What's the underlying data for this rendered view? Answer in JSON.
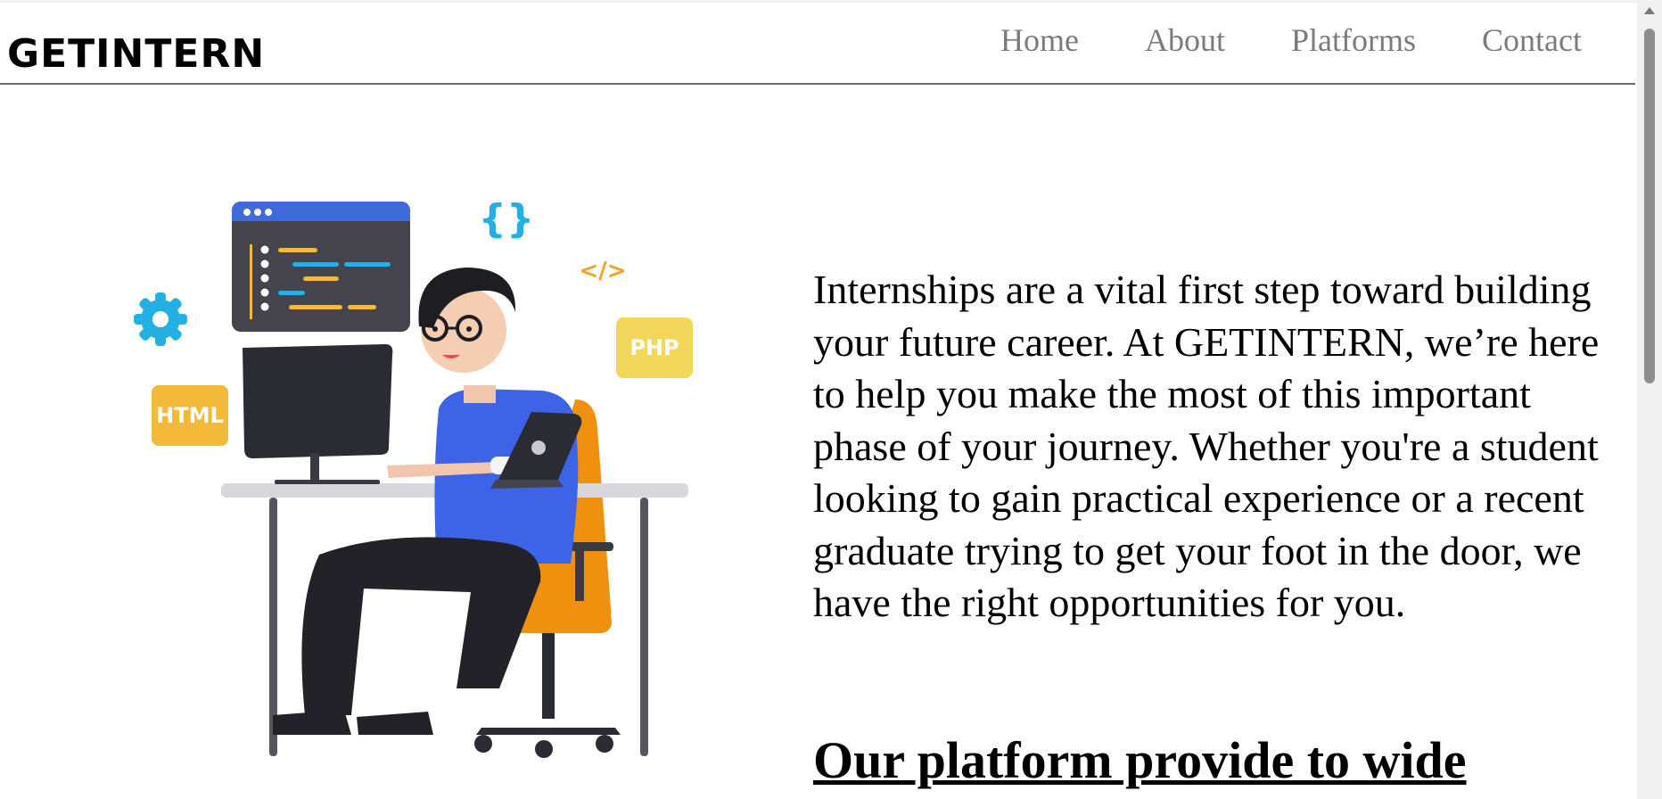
{
  "header": {
    "logo": "GETINTERN",
    "nav": [
      "Home",
      "About",
      "Platforms",
      "Contact"
    ]
  },
  "hero": {
    "illustration": {
      "badge_html": "HTML",
      "badge_php": "PHP",
      "braces": "{}",
      "code_tag": "</>"
    },
    "intro": "Internships are a vital first step toward building your future career. At GETINTERN, we’re here to help you make the most of this important phase of your journey. Whether you're a student looking to gain practical experience or a recent graduate trying to get your foot in the door, we have the right opportunities for you.",
    "heading": "Our platform provide to wide"
  },
  "colors": {
    "nav_text": "#7b7b7b",
    "rule": "#6b6b6b",
    "shirt": "#3d63e6",
    "chair": "#f0900f",
    "badge": "#f2b93b",
    "accent_cyan": "#25b0e3"
  }
}
